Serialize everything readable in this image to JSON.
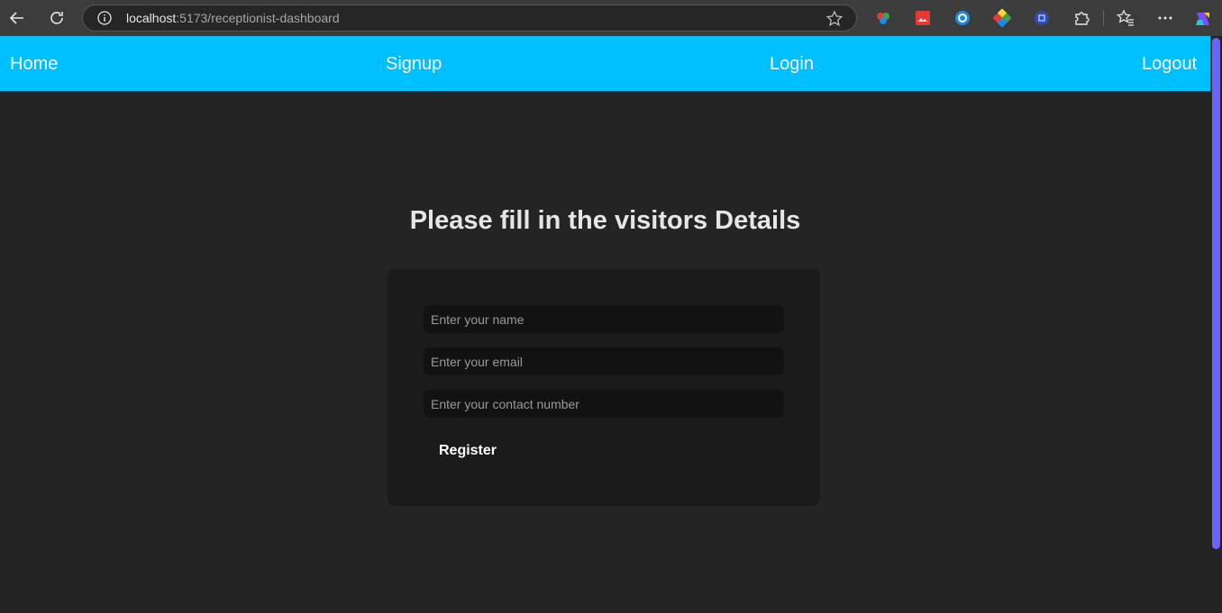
{
  "browser": {
    "url_host": "localhost",
    "url_rest": ":5173/receptionist-dashboard",
    "icons": [
      "back-arrow-icon",
      "refresh-icon",
      "site-info-icon",
      "favorite-star-icon",
      "extensions-icon",
      "favorites-icon",
      "more-menu-icon",
      "copilot-icon"
    ]
  },
  "navbar": {
    "home": "Home",
    "signup": "Signup",
    "login": "Login",
    "logout": "Logout",
    "color": "#00bfff"
  },
  "form": {
    "heading": "Please fill in the visitors Details",
    "name_placeholder": "Enter your name",
    "email_placeholder": "Enter your email",
    "contact_placeholder": "Enter your contact number",
    "name_value": "",
    "email_value": "",
    "contact_value": "",
    "register_label": "Register"
  }
}
